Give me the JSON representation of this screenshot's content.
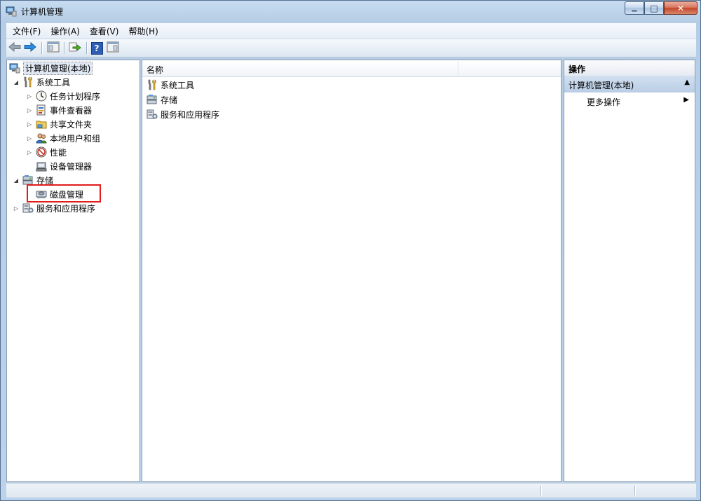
{
  "window": {
    "title": "计算机管理",
    "minimize_glyph": "▁",
    "maximize_glyph": "□",
    "close_glyph": "✕"
  },
  "menu": [
    "文件(F)",
    "操作(A)",
    "查看(V)",
    "帮助(H)"
  ],
  "toolbar": {
    "icons": [
      "back-arrow-icon",
      "forward-arrow-icon",
      "show-hide-console-tree-icon",
      "export-list-icon",
      "help-icon",
      "show-hide-action-pane-icon"
    ],
    "help_glyph": "?"
  },
  "tree": {
    "root": "计算机管理(本地)",
    "system_tools": "系统工具",
    "task_scheduler": "任务计划程序",
    "event_viewer": "事件查看器",
    "shared_folders": "共享文件夹",
    "local_users": "本地用户和组",
    "performance": "性能",
    "device_manager": "设备管理器",
    "storage": "存储",
    "disk_management": "磁盘管理",
    "services_apps": "服务和应用程序",
    "expanded_glyph": "◢",
    "collapsed_glyph": "▷"
  },
  "list": {
    "column_name": "名称",
    "items": [
      "系统工具",
      "存储",
      "服务和应用程序"
    ]
  },
  "actions": {
    "header": "操作",
    "section": "计算机管理(本地)",
    "section_arrow": "▲",
    "more": "更多操作",
    "more_arrow": "▶"
  },
  "colors": {
    "highlight_border": "#e21b1b",
    "selection_bg": "#dfe8f3",
    "action_section_bg": "#c4d6ec"
  }
}
